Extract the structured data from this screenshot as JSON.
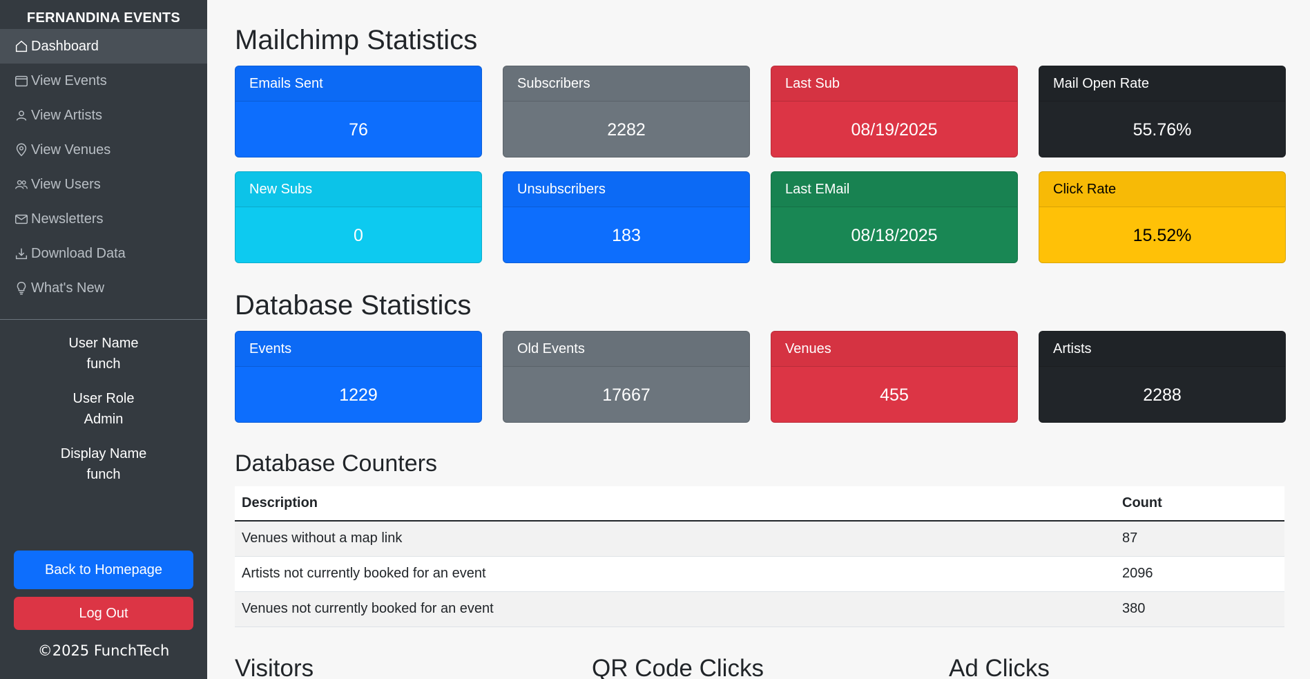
{
  "sidebar": {
    "brand": "FERNANDINA EVENTS",
    "nav": [
      {
        "label": "Dashboard",
        "icon": "house-icon",
        "active": true
      },
      {
        "label": "View Events",
        "icon": "calendar-icon"
      },
      {
        "label": "View Artists",
        "icon": "person-icon"
      },
      {
        "label": "View Venues",
        "icon": "map-pin-icon"
      },
      {
        "label": "View Users",
        "icon": "people-icon"
      },
      {
        "label": "Newsletters",
        "icon": "envelope-icon"
      },
      {
        "label": "Download Data",
        "icon": "download-icon"
      },
      {
        "label": "What's New",
        "icon": "lightbulb-icon"
      }
    ],
    "user": {
      "name_label": "User Name",
      "name_value": "funch",
      "role_label": "User Role",
      "role_value": "Admin",
      "display_label": "Display Name",
      "display_value": "funch"
    },
    "home_button": "Back to Homepage",
    "logout_button": "Log Out",
    "copyright": "©2025 FunchTech"
  },
  "mailchimp": {
    "title": "Mailchimp Statistics",
    "cards": [
      {
        "label": "Emails Sent",
        "value": "76",
        "color": "#0d6efd"
      },
      {
        "label": "Subscribers",
        "value": "2282",
        "color": "#6c757d"
      },
      {
        "label": "Last Sub",
        "value": "08/19/2025",
        "color": "#dc3545"
      },
      {
        "label": "Mail Open Rate",
        "value": "55.76%",
        "color": "#212529"
      },
      {
        "label": "New Subs",
        "value": "0",
        "color": "#0dcaf0"
      },
      {
        "label": "Unsubscribers",
        "value": "183",
        "color": "#0d6efd"
      },
      {
        "label": "Last EMail",
        "value": "08/18/2025",
        "color": "#198754"
      },
      {
        "label": "Click Rate",
        "value": "15.52%",
        "color": "#ffc107"
      }
    ]
  },
  "database": {
    "title": "Database Statistics",
    "cards": [
      {
        "label": "Events",
        "value": "1229",
        "color": "#0d6efd"
      },
      {
        "label": "Old Events",
        "value": "17667",
        "color": "#6c757d"
      },
      {
        "label": "Venues",
        "value": "455",
        "color": "#dc3545"
      },
      {
        "label": "Artists",
        "value": "2288",
        "color": "#212529"
      }
    ]
  },
  "counters": {
    "title": "Database Counters",
    "headers": {
      "description": "Description",
      "count": "Count"
    },
    "rows": [
      {
        "description": "Venues without a map link",
        "count": "87"
      },
      {
        "description": "Artists not currently booked for an event",
        "count": "2096"
      },
      {
        "description": "Venues not currently booked for an event",
        "count": "380"
      }
    ]
  },
  "bottom": {
    "visitors": "Visitors",
    "qr_clicks": "QR Code Clicks",
    "ad_clicks": "Ad Clicks"
  }
}
